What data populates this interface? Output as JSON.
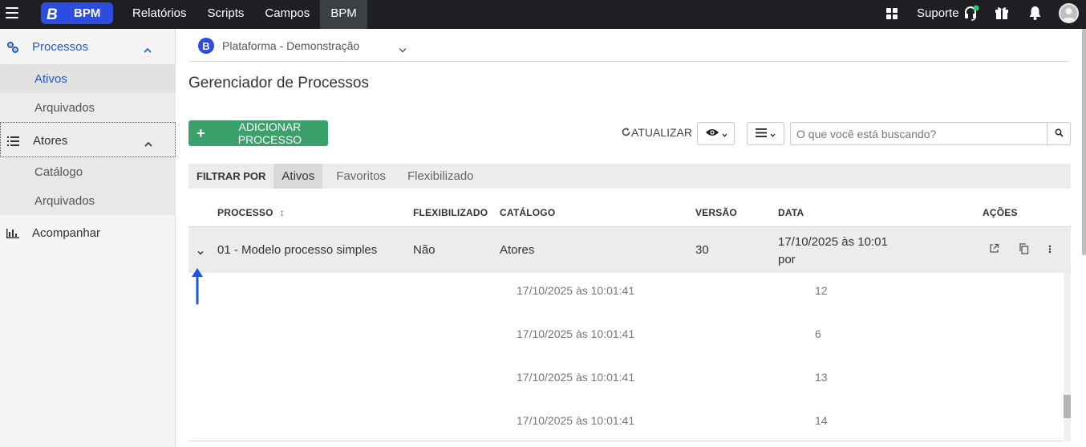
{
  "topbar": {
    "brand": "BPM",
    "brand_logo_letter": "B",
    "nav": [
      {
        "label": "Relatórios",
        "active": false
      },
      {
        "label": "Scripts",
        "active": false
      },
      {
        "label": "Campos",
        "active": false
      },
      {
        "label": "BPM",
        "active": true
      }
    ],
    "support_label": "Suporte",
    "status_dot_color": "#2ecc71"
  },
  "sidebar": {
    "sections": [
      {
        "label": "Processos",
        "icon": "gears-icon",
        "expanded": true,
        "items": [
          {
            "label": "Ativos",
            "active": true
          },
          {
            "label": "Arquivados",
            "active": false
          }
        ]
      },
      {
        "label": "Atores",
        "icon": "list-icon",
        "expanded": true,
        "items": [
          {
            "label": "Catálogo"
          },
          {
            "label": "Arquivados"
          }
        ]
      },
      {
        "label": "Acompanhar",
        "icon": "bar-chart-icon"
      }
    ]
  },
  "main": {
    "platform": {
      "logo_letter": "B",
      "name": "Plataforma - Demonstração"
    },
    "title": "Gerenciador de Processos",
    "add_button": {
      "icon": "+",
      "label": "ADICIONAR PROCESSO"
    },
    "refresh_label": "ATUALIZAR",
    "search_placeholder": "O que você está buscando?",
    "filter": {
      "label": "FILTRAR POR",
      "tabs": [
        {
          "label": "Ativos",
          "active": true
        },
        {
          "label": "Favoritos"
        },
        {
          "label": "Flexibilizado"
        }
      ]
    },
    "table": {
      "headers": {
        "processo": "PROCESSO",
        "flexibilizado": "FLEXIBILIZADO",
        "catalogo": "CATÁLOGO",
        "versao": "VERSÃO",
        "data": "DATA",
        "acoes": "AÇÕES"
      },
      "sort_icon": "↕",
      "row": {
        "processo": "01 - Modelo processo simples",
        "flexibilizado": "Não",
        "catalogo": "Atores",
        "versao": "30",
        "data_line1": "17/10/2025 às 10:01",
        "data_line2": "por"
      },
      "subrows": [
        {
          "data": "17/10/2025 às 10:01:41",
          "versao": "12"
        },
        {
          "data": "17/10/2025 às 10:01:41",
          "versao": "6"
        },
        {
          "data": "17/10/2025 às 10:01:41",
          "versao": "13"
        },
        {
          "data": "17/10/2025 às 10:01:41",
          "versao": "14"
        }
      ]
    }
  },
  "colors": {
    "accent": "#2359c9",
    "brand": "#2d4de0",
    "add_button": "#3ba16b",
    "arrow": "#1e56d6"
  }
}
